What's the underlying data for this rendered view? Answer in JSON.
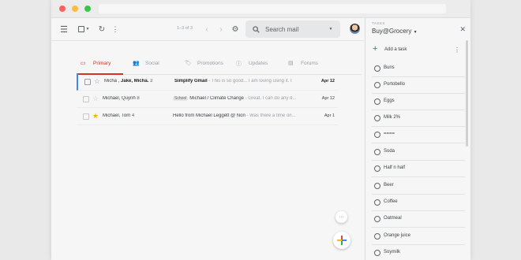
{
  "toolbar": {
    "pager": "1–3 of 3",
    "search_placeholder": "Search mail"
  },
  "tabs": [
    {
      "label": "Primary",
      "icon": "inbox-icon"
    },
    {
      "label": "Social",
      "icon": "people-icon"
    },
    {
      "label": "Promotions",
      "icon": "tag-icon"
    },
    {
      "label": "Updates",
      "icon": "info-icon"
    },
    {
      "label": "Forums",
      "icon": "forum-icon"
    }
  ],
  "emails": [
    {
      "from_pre": "Micha , ",
      "from_bold": "Jake, Micha.",
      "count": "3",
      "badge": "",
      "subject": "Simplify Gmail",
      "snippet": " - This is so good... I am loving using it. I",
      "date": "Apr 12",
      "starred": false
    },
    {
      "from_pre": "Michael, Quynh",
      "from_bold": "",
      "count": "8",
      "badge": "School",
      "subject": "Michael / Climate Change",
      "snippet": " - Great. I can do any d...",
      "date": "Apr 12",
      "starred": false
    },
    {
      "from_pre": "Michael, Tom",
      "from_bold": "",
      "count": "4",
      "badge": "",
      "subject": "Hello from Michael Leggett @ Non",
      "snippet": " - Was there a time on...",
      "date": "Apr 1",
      "starred": true
    }
  ],
  "tasks_panel": {
    "header": "TASKS",
    "list_name": "Buy@Grocery",
    "add_task": "Add a task",
    "items": [
      "Buns",
      "Portobello",
      "Eggs",
      "Milk 2%",
      "====",
      "Soda",
      "Half n half",
      "Beer",
      "Coffee",
      "Oatmeal",
      "Orange juice",
      "Soymilk"
    ]
  },
  "colors": {
    "accent": "#d93025",
    "compose_blue": "#4285f4",
    "star": "#f4b400"
  }
}
